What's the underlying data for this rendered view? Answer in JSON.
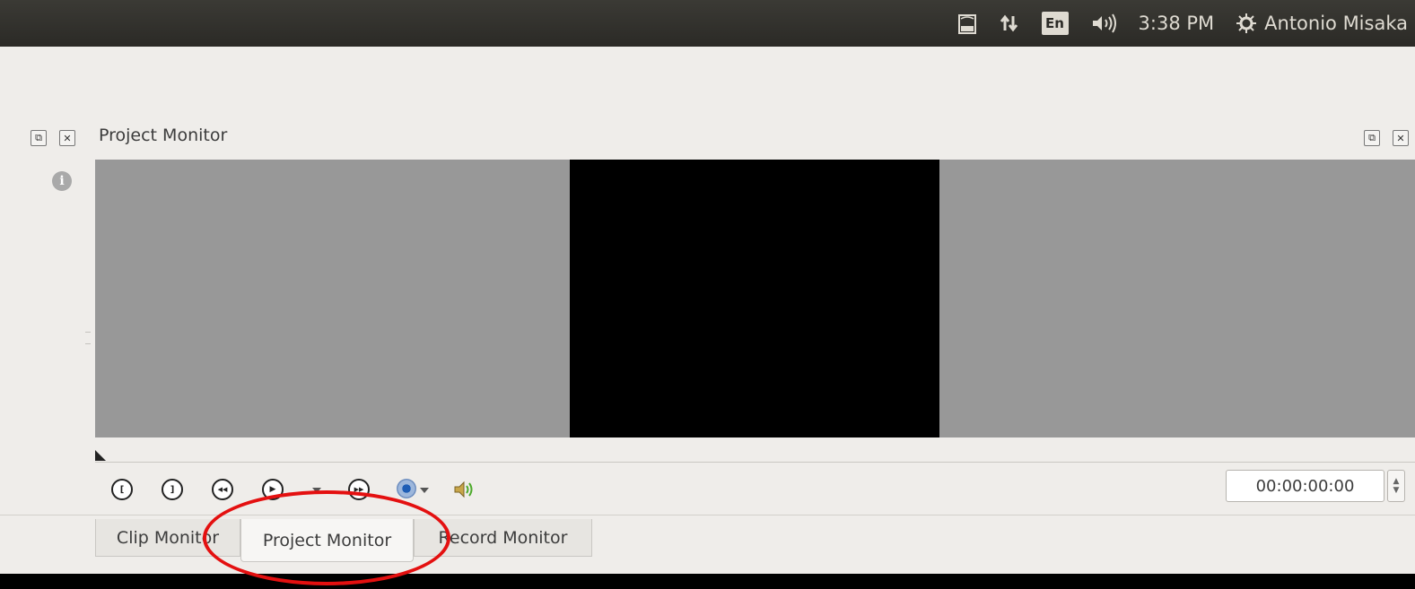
{
  "system_panel": {
    "items": [
      {
        "name": "battery-icon",
        "label": ""
      },
      {
        "name": "network-updown-icon",
        "label": ""
      },
      {
        "name": "keyboard-layout",
        "label": "En"
      },
      {
        "name": "volume-icon",
        "label": ""
      }
    ],
    "clock": "3:38 PM",
    "user": "Antonio Misaka"
  },
  "dock": {
    "title": "Project Monitor",
    "float_icon": "⧉",
    "close_icon": "✕"
  },
  "controls": {
    "buttons": [
      {
        "name": "set-zone-start-button",
        "glyph": "["
      },
      {
        "name": "set-zone-end-button",
        "glyph": "]"
      },
      {
        "name": "rewind-button",
        "glyph": "◀◀"
      },
      {
        "name": "play-button",
        "glyph": "▶"
      },
      {
        "name": "forward-button",
        "glyph": "▶▶"
      }
    ],
    "timecode": "00:00:00:00"
  },
  "tabs": [
    {
      "label": "Clip Monitor",
      "active": false
    },
    {
      "label": "Project Monitor",
      "active": true
    },
    {
      "label": "Record Monitor",
      "active": false
    }
  ],
  "colors": {
    "panel": "#2b2a26",
    "window": "#efedea",
    "monitor_bg": "#989898",
    "annotation": "#e41010"
  }
}
